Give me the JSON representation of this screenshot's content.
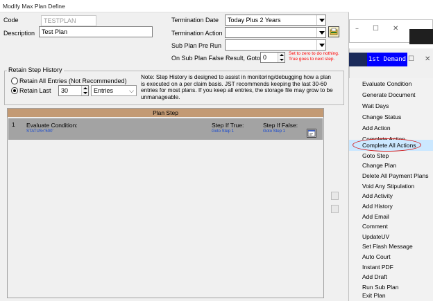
{
  "window": {
    "title": "Modify Max Plan Define"
  },
  "background": {
    "button_label": "1st Demand"
  },
  "form": {
    "code_label": "Code",
    "code_value": "TESTPLAN",
    "description_label": "Description",
    "description_value": "Test Plan",
    "termination_date_label": "Termination Date",
    "termination_date_value": "Today Plus 2 Years",
    "termination_action_label": "Termination Action",
    "termination_action_value": "",
    "sub_plan_pre_run_label": "Sub Plan Pre Run",
    "sub_plan_pre_run_value": "",
    "false_result_label": "On Sub Plan False Result, Goto:",
    "false_result_value": "0",
    "false_result_hint_line1": "Set to zero to do nothing.",
    "false_result_hint_line2": "True goes to next step."
  },
  "retain": {
    "legend": "Retain Step History",
    "option_all": "Retain All Entries (Not Recommended)",
    "option_last": "Retain Last",
    "last_value": "30",
    "unit_value": "Entries",
    "selected": "Retain Last",
    "note": "Note: Step History is designed to assist in monitoring/debugging how a plan is executed on a per claim basis. JST recommends keeping the last 30-60 entries for most plans. If you keep all entries, the storage file may grow to be unmanageable."
  },
  "plan_steps": {
    "header": "Plan Step",
    "rows": [
      {
        "number": "1",
        "title": "Evaluate Condition:",
        "detail": "STATUS<'500'",
        "true_label": "Step If True:",
        "true_value": "Goto Step 1",
        "false_label": "Step If False:",
        "false_value": "Goto Step 1"
      }
    ]
  },
  "context_menu": {
    "highlighted": "Complete All Actions",
    "items": [
      "Evaluate Condition",
      "Generate Document",
      "Wait Days",
      "Change Status",
      "Add Action",
      "Complete Action",
      "Complete All Actions",
      "Goto Step",
      "Change Plan",
      "Delete All Payment Plans",
      "Void Any Stipulation",
      "Add Activity",
      "Add History",
      "Add Email",
      "Comment",
      "UpdateUV",
      "Set Flash Message",
      "Auto Court",
      "Instant PDF",
      "Add Draft",
      "Run Sub Plan",
      "Exit Plan"
    ]
  },
  "colors": {
    "header_bg": "#c39a74",
    "step_row_bg": "#a3a3a3",
    "menu_highlight": "#cce8ff",
    "annotation_circle": "#d42020",
    "hint_text": "#ff0000"
  }
}
